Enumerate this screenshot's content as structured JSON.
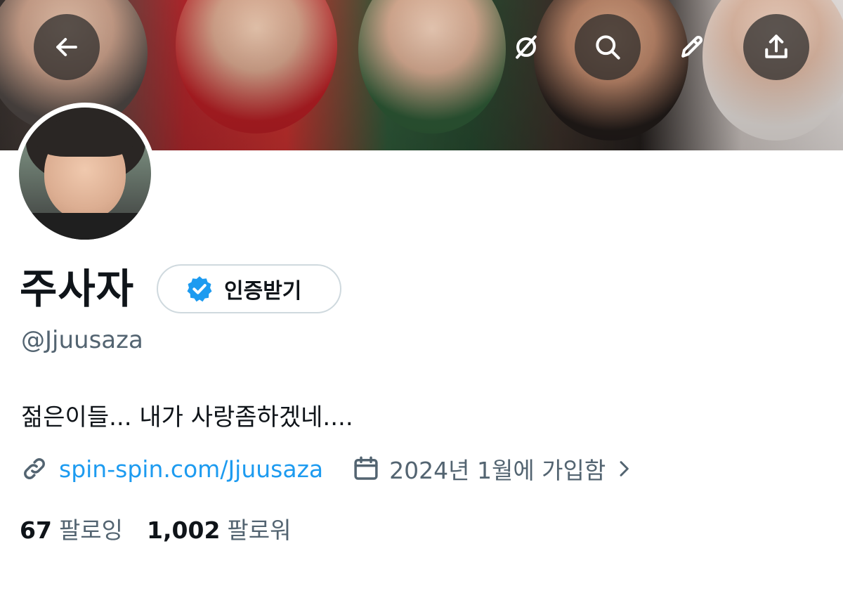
{
  "header": {
    "back_icon": "arrow-left-icon",
    "actions": [
      {
        "icon": "no-translate-icon"
      },
      {
        "icon": "search-icon"
      },
      {
        "icon": "pencil-icon"
      },
      {
        "icon": "share-icon"
      }
    ]
  },
  "profile": {
    "name": "주사자",
    "verify_label": "인증받기",
    "handle": "@Jjuusaza",
    "bio": "젊은이들... 내가 사랑좀하겠네....",
    "link": "spin-spin.com/Jjuusaza",
    "joined": "2024년 1월에 가입함",
    "following_count": "67",
    "following_label": "팔로잉",
    "followers_count": "1,002",
    "followers_label": "팔로워"
  },
  "colors": {
    "link": "#1d9bf0",
    "secondary_text": "#536471",
    "verified_badge": "#1d9bf0"
  }
}
